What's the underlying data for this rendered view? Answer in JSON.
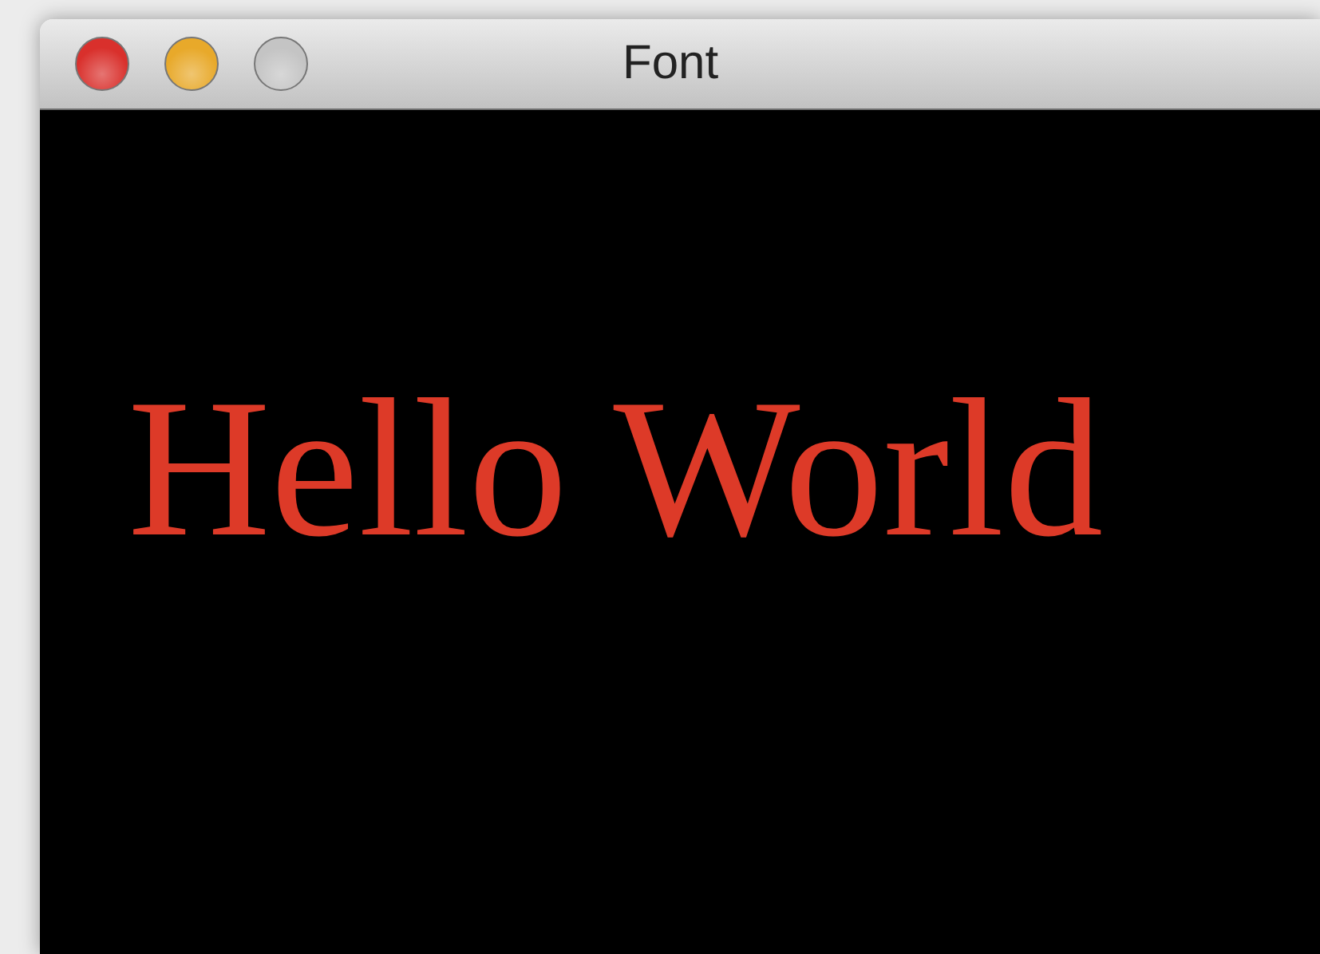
{
  "window": {
    "title": "Font"
  },
  "window_buttons": [
    {
      "color": "#d9302c"
    },
    {
      "color": "#e8a92a"
    },
    {
      "color": "#c4c4c4"
    }
  ],
  "content": {
    "text": "Hello World",
    "color": "#dd3a28"
  }
}
